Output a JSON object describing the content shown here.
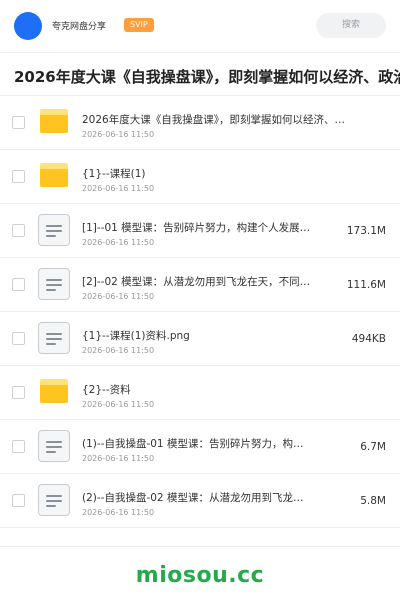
{
  "header": {
    "brand": "夸克网盘分享",
    "badge": "SVIP",
    "search_placeholder": "搜索"
  },
  "page_title": "2026年度大课《自我操盘课》，即刻掌握如何以经济、政治、",
  "files": [
    {
      "kind": "folder",
      "name": "2026年度大课《自我操盘课》，即刻掌握如何以经济、政治…",
      "date": "2026-06-16 11:50",
      "size": ""
    },
    {
      "kind": "folder",
      "name": "{1}--课程(1)",
      "date": "2026-06-16 11:50",
      "size": ""
    },
    {
      "kind": "file",
      "name": "[1]--01 模型课：告别碎片努力，构建个人发展…",
      "date": "2026-06-16 11:50",
      "size": "173.1M"
    },
    {
      "kind": "file",
      "name": "[2]--02 模型课：从潜龙勿用到飞龙在天，不同…",
      "date": "2026-06-16 11:50",
      "size": "111.6M"
    },
    {
      "kind": "file",
      "name": "{1}--课程(1)资料.png",
      "date": "2026-06-16 11:50",
      "size": "494KB"
    },
    {
      "kind": "folder",
      "name": "{2}--资料",
      "date": "2026-06-16 11:50",
      "size": ""
    },
    {
      "kind": "file",
      "name": "(1)--自我操盘-01 模型课：告别碎片努力，构…",
      "date": "2026-06-16 11:50",
      "size": "6.7M"
    },
    {
      "kind": "file",
      "name": "(2)--自我操盘-02 模型课：从潜龙勿用到飞龙…",
      "date": "2026-06-16 11:50",
      "size": "5.8M"
    }
  ],
  "watermark": "miosou.cc",
  "colors": {
    "accent_blue": "#1e6ff5",
    "svip_orange": "#ff9e3b",
    "folder_yellow": "#ffc41f",
    "watermark_green": "#27a84a"
  },
  "icons": {
    "folder": "folder-icon",
    "file": "document-icon"
  }
}
